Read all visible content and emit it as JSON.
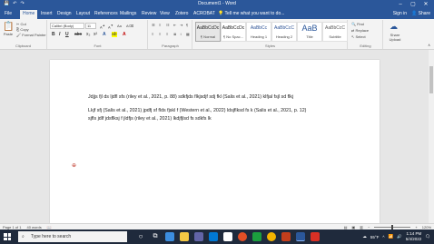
{
  "window": {
    "title": "Document1 - Word",
    "controls": [
      "–",
      "▢",
      "✕"
    ]
  },
  "tabs": {
    "items": [
      "File",
      "Home",
      "Insert",
      "Design",
      "Layout",
      "References",
      "Mailings",
      "Review",
      "View",
      "Zotero",
      "ACROBAT"
    ],
    "active": "Home",
    "tell_me": "Tell me what you want to do...",
    "sign_in": "Sign in",
    "share": "Share"
  },
  "ribbon": {
    "clipboard": {
      "paste": "Paste",
      "cut": "Cut",
      "copy": "Copy",
      "format_painter": "Format Painter",
      "label": "Clipboard"
    },
    "font": {
      "name": "Calibri (Body)",
      "size": "11",
      "label": "Font",
      "bold": "B",
      "italic": "I",
      "underline": "U"
    },
    "paragraph": {
      "label": "Paragraph"
    },
    "styles": {
      "label": "Styles",
      "items": [
        {
          "sample": "AaBbCcDc",
          "name": "¶ Normal"
        },
        {
          "sample": "AaBbCcDc",
          "name": "¶ No Spac..."
        },
        {
          "sample": "AaBbCc",
          "name": "Heading 1"
        },
        {
          "sample": "AaBbCcC",
          "name": "Heading 2"
        },
        {
          "sample": "AaB",
          "name": "Title"
        },
        {
          "sample": "AaBbCcC",
          "name": "Subtitle"
        }
      ]
    },
    "editing": {
      "find": "Find",
      "replace": "Replace",
      "select": "Select",
      "label": "Editing"
    },
    "share_upload": {
      "label": "Share Upload"
    }
  },
  "document": {
    "paragraphs": [
      "Jdjjs fjl ds ljdfl sfs (riley et al., 2021, p. 88) sdkfjds flkjsdjf sdj fkl (Salis et al., 2021) klfjal fsjl sd flkj",
      "Lkjf sfj (Salis et al., 2021) jpdfj sf flds fjskl f (Western et al., 2022) ldsjflksd fs k (Salis et al., 2021, p. 12)",
      "sjfls jdlf  jdsflksj f jldfjs (riley et al., 2021) lkdjfjlsd fs  sdkfs  lk"
    ]
  },
  "status": {
    "page": "Page 1 of 1",
    "words": "40 words",
    "zoom": "120%"
  },
  "taskbar": {
    "search_placeholder": "Type here to search",
    "weather": "55°F",
    "time": "1:14 PM",
    "date": "5/4/2022"
  },
  "colors": {
    "word_blue": "#2b579a",
    "taskbar": "#1f2a3c"
  }
}
